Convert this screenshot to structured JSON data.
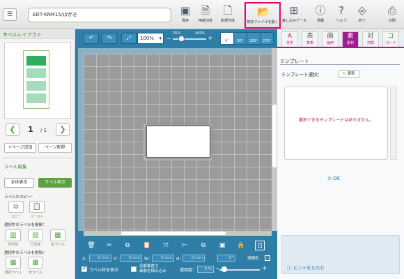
{
  "header": {
    "filename": "EDT-KNM15/はがき",
    "buttons": [
      {
        "label": "保存",
        "icon": "save-icon"
      },
      {
        "label": "用紙切替",
        "icon": "paper-switch-icon"
      },
      {
        "label": "新規作成",
        "icon": "new-file-icon"
      },
      {
        "label": "既存ファイルを開く",
        "icon": "folder-open-icon"
      },
      {
        "label": "差し込みデータ",
        "icon": "merge-data-icon"
      },
      {
        "label": "情報",
        "icon": "info-icon"
      },
      {
        "label": "ヘルプ",
        "icon": "help-icon"
      },
      {
        "label": "終了",
        "icon": "exit-icon"
      },
      {
        "label": "印刷",
        "icon": "print-icon"
      }
    ],
    "highlight_color": "#e5006e"
  },
  "left": {
    "title": "ラベルレイアウト",
    "close": "×",
    "page_current": "1",
    "page_total": "/ 1",
    "add_page": "+ページ追加",
    "delete_page": "ページ削除",
    "label_edit_title": "ラベル編集",
    "all_view": "全体表示",
    "label_view": "ラベル表示",
    "label_copy_title": "ラベルのコピー：",
    "copy": "コピー",
    "paste": "ペースト",
    "expand_title": "選択中のラベルを展開：",
    "expand_col": "列全体",
    "expand_row": "行全体",
    "expand_all": "全ラベル",
    "delete_title": "選択中のラベルを削除：",
    "delete_sel": "選択ラベル",
    "delete_all": "全ラベル",
    "accent": "#5aa340"
  },
  "canvas": {
    "zoom": "100%",
    "zoom_min": "25%",
    "zoom_max": "400%",
    "rotations": [
      "0°",
      "90°",
      "180°",
      "270°"
    ]
  },
  "bottom": {
    "x_label": "X：",
    "x_value": "0 mm",
    "y_label": "Y：",
    "y_value": "0 mm",
    "w_label": "W：",
    "w_value": "0 mm",
    "h_label": "H：",
    "h_value": "0 mm",
    "angle": "0°",
    "transparent_color": "透明色",
    "show_frame": "ラベル枠を表示",
    "hq_load": "高解像度で\n画像を読み込み",
    "transparency_label": "透明度：",
    "transparency_value": "0 %"
  },
  "right": {
    "tabs": [
      {
        "label": "文字",
        "icon": "A"
      },
      {
        "label": "表李",
        "icon": "表"
      },
      {
        "label": "画用",
        "icon": "画"
      },
      {
        "label": "素材",
        "icon": "素"
      },
      {
        "label": "対顔",
        "icon": "対"
      },
      {
        "label": "コード",
        "icon": "コ"
      }
    ],
    "active_tab_color": "#a11c8d",
    "template_title": "テンプレート",
    "template_select": "テンプレート選択：",
    "refresh": "更新",
    "no_template": "選択できるテンプレートはありません。",
    "ok": "OK",
    "hint_toggle": "ヒントをたたむ"
  }
}
